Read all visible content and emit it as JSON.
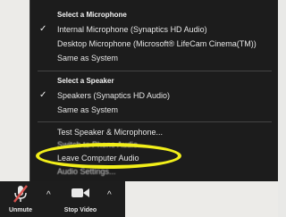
{
  "microphone_section": {
    "header": "Select a Microphone",
    "items": [
      {
        "label": "Internal Microphone (Synaptics HD Audio)",
        "checked": true
      },
      {
        "label": "Desktop Microphone (Microsoft® LifeCam Cinema(TM))",
        "checked": false
      },
      {
        "label": "Same as System",
        "checked": false
      }
    ]
  },
  "speaker_section": {
    "header": "Select a Speaker",
    "items": [
      {
        "label": "Speakers (Synaptics HD Audio)",
        "checked": true
      },
      {
        "label": "Same as System",
        "checked": false
      }
    ]
  },
  "actions": {
    "test": "Test Speaker & Microphone...",
    "switch": "Switch to Phone Audio...",
    "leave": "Leave Computer Audio",
    "settings": "Audio Settings..."
  },
  "toolbar": {
    "unmute_label": "Unmute",
    "stop_video_label": "Stop Video"
  },
  "checkmark": "✓",
  "colors": {
    "menu_bg": "#1c1c1c",
    "highlight": "#f2ef1a",
    "mute_red": "#d9534f"
  }
}
